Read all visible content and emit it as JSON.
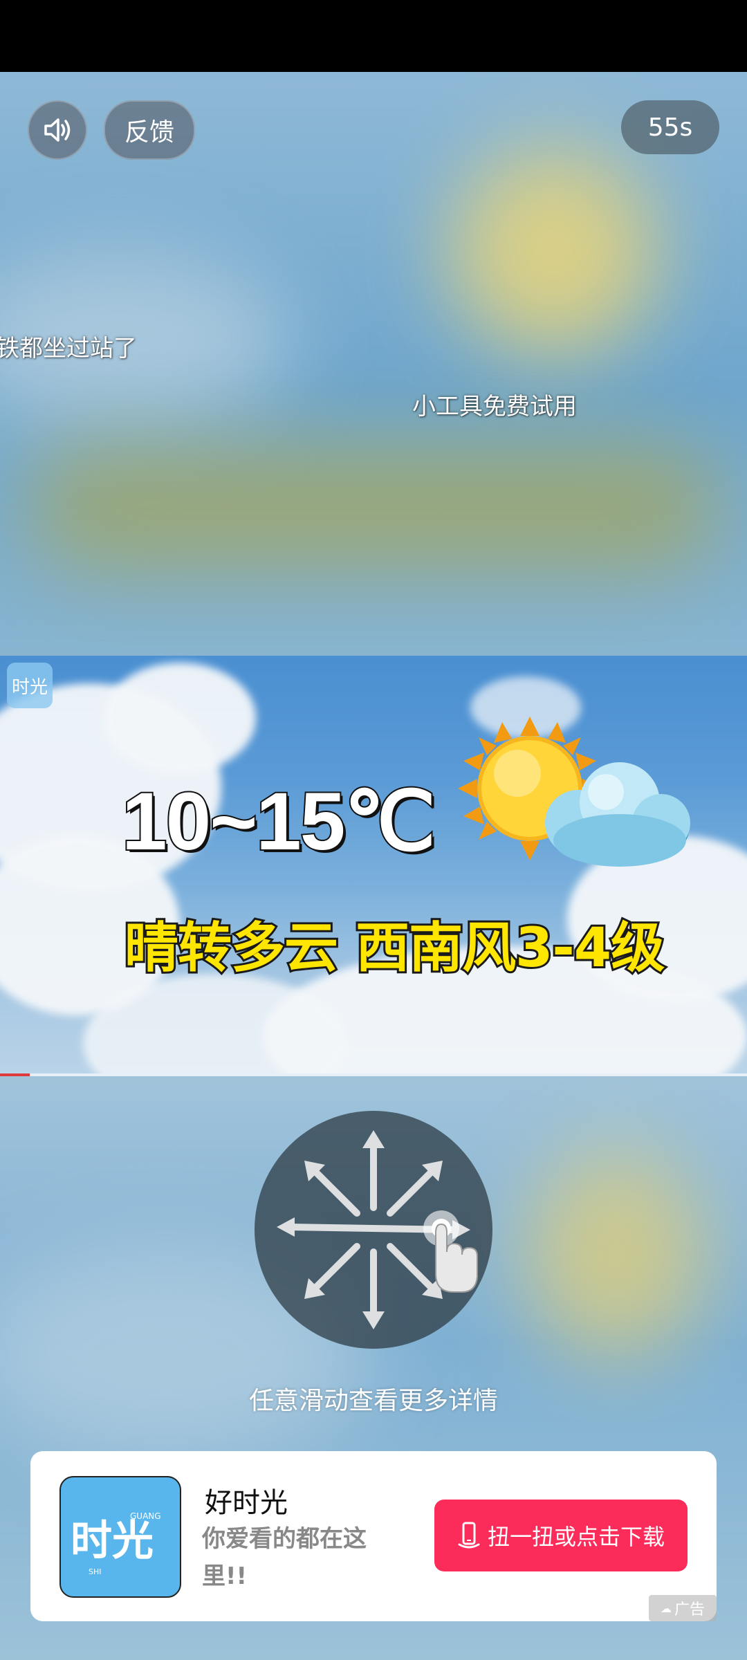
{
  "top_controls": {
    "sound_icon": "speaker-icon",
    "feedback_label": "反馈",
    "countdown": "55s"
  },
  "danmaku": [
    {
      "text": "铁都坐过站了"
    },
    {
      "text": "小工具免费试用"
    }
  ],
  "video": {
    "watermark_logo": "时光",
    "temperature": "10~15℃",
    "weather_line": "晴转多云 西南风3-4级",
    "progress_fraction": 0.04,
    "colors": {
      "highlight": "#ffe600",
      "progress": "#e03a3a"
    }
  },
  "swipe": {
    "icon": "swipe-gesture-icon",
    "hint": "任意滑动查看更多详情"
  },
  "ad": {
    "app_name": "好时光",
    "description": "你爱看的都在这里!!",
    "download_label": "扭一扭或点击下载",
    "button_color": "#fb2b5a",
    "ad_label": "广告"
  }
}
